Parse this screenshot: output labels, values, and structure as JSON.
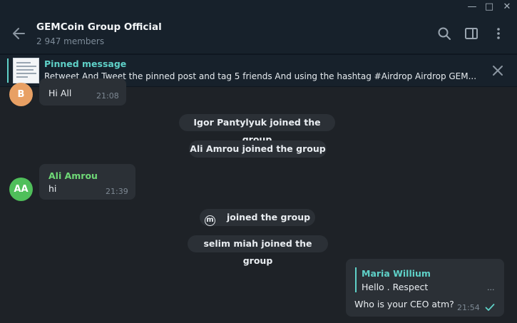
{
  "window": {
    "minimize_glyph": "—",
    "maximize_glyph": "□",
    "close_glyph": "✕"
  },
  "header": {
    "title": "GEMCoin Group Official",
    "subtitle": "2 947 members",
    "icons": [
      "back-arrow-icon",
      "search-icon",
      "sidebar-toggle-icon",
      "more-vertical-icon"
    ]
  },
  "pinned": {
    "label": "Pinned message",
    "text": "Retweet And Tweet the pinned post and tag 5 friends And using the hashtag #Airdrop Airdrop GEM..."
  },
  "messages": [
    {
      "avatar": "B",
      "avatar_color": "#e8a064",
      "text": "Hi All",
      "time": "21:08"
    },
    {
      "avatar": "AA",
      "avatar_color": "#4fbf5a",
      "sender": "Ali Amrou",
      "sender_color": "#6fd977",
      "text": "hi",
      "time": "21:39"
    }
  ],
  "service": [
    {
      "text": "Igor Pantylyuk joined the group"
    },
    {
      "text": "Ali Amrou joined the group"
    },
    {
      "glyph": "m",
      "text": "joined the group"
    },
    {
      "text": "selim miah joined the group"
    }
  ],
  "outgoing": {
    "reply_to_name": "Maria Willium",
    "reply_to_text": "Hello . Respect",
    "reply_ellipsis": "...",
    "text": "Who is your CEO atm?",
    "time": "21:54",
    "status_icon": "check-icon"
  },
  "colors": {
    "accent": "#5fd1c8",
    "chat_bg": "#1e2227",
    "header_bg": "#17212b",
    "bubble": "#2b3036"
  }
}
